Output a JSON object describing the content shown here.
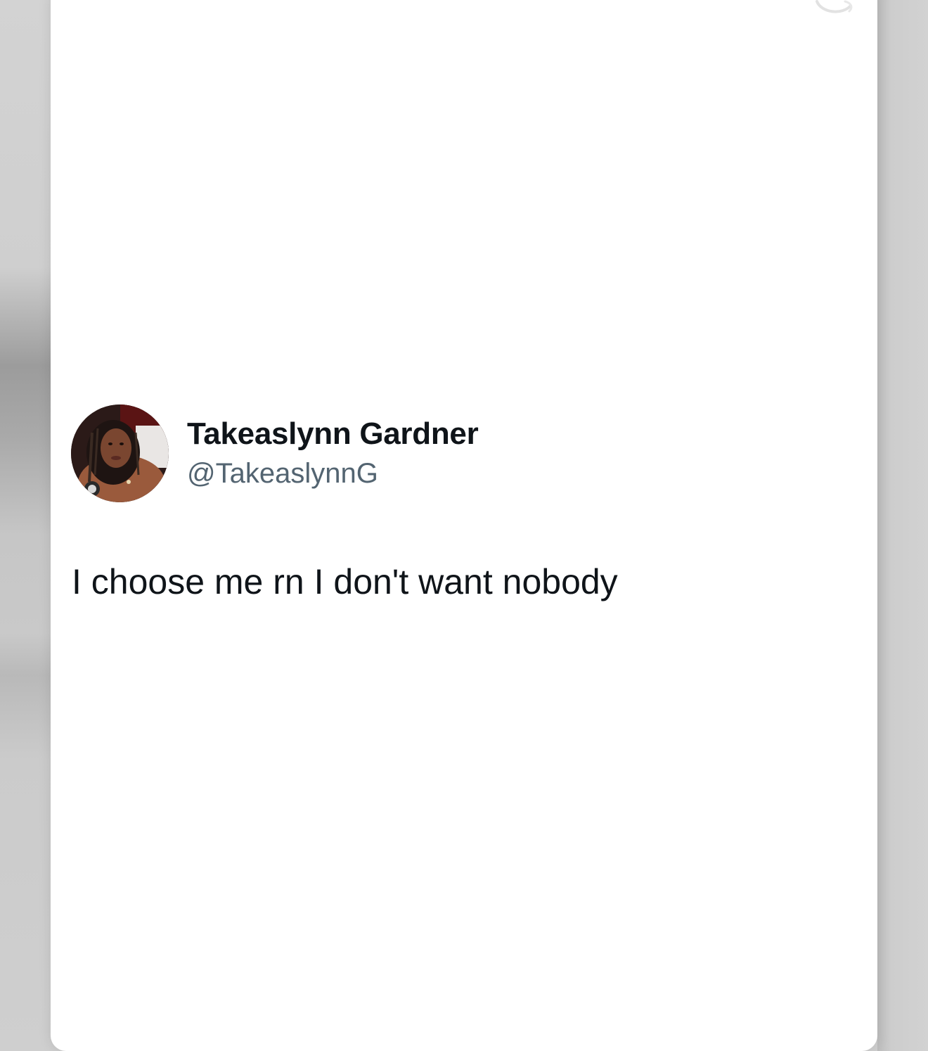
{
  "tweet": {
    "author": {
      "display_name": "Takeaslynn Gardner",
      "handle": "@TakeaslynnG",
      "avatar_icon": "profile-photo"
    },
    "text": "I choose me rn I don't want nobody"
  },
  "colors": {
    "background": "#d0d0d0",
    "card": "#ffffff",
    "name_text": "#0f1419",
    "handle_text": "#536471",
    "body_text": "#0f1419"
  }
}
